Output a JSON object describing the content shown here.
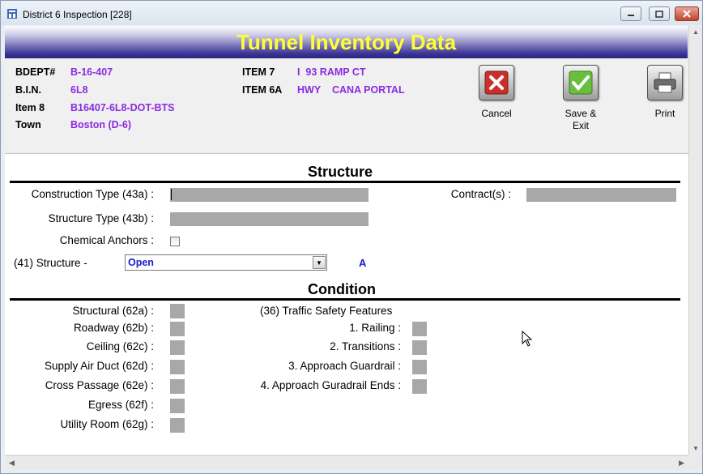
{
  "window": {
    "title": "District 6 Inspection [228]"
  },
  "banner": {
    "title": "Tunnel Inventory Data"
  },
  "header": {
    "bdept_label": "BDEPT#",
    "bdept_value": "B-16-407",
    "bin_label": "B.I.N.",
    "bin_value": "6L8",
    "item8_label": "Item 8",
    "item8_value": "B16407-6L8-DOT-BTS",
    "town_label": "Town",
    "town_value": "Boston (D-6)",
    "item7_label": "ITEM 7",
    "item7_value": "I  93 RAMP CT",
    "item6a_label": "ITEM 6A",
    "item6a_value1": "HWY",
    "item6a_value2": "CANA PORTAL"
  },
  "actions": {
    "cancel_label": "Cancel",
    "save_label_1": "Save &",
    "save_label_2": "Exit",
    "print_label": "Print"
  },
  "structure": {
    "title": "Structure",
    "construction_type_label": "Construction Type (43a) :",
    "structure_type_label": "Structure Type (43b) :",
    "contracts_label": "Contract(s) :",
    "chemical_anchors_label": "Chemical Anchors :",
    "structure_41_label": "(41) Structure -",
    "structure_41_value": "Open",
    "structure_41_code": "A"
  },
  "condition": {
    "title": "Condition",
    "items": [
      {
        "label": "Structural (62a) :"
      },
      {
        "label": "Roadway (62b) :"
      },
      {
        "label": "Ceiling (62c) :"
      },
      {
        "label": "Supply Air Duct (62d) :"
      },
      {
        "label": "Cross Passage (62e) :"
      },
      {
        "label": "Egress (62f) :"
      },
      {
        "label": "Utility Room (62g) :"
      }
    ],
    "traffic_title": "(36) Traffic Safety Features",
    "traffic_items": [
      {
        "label": "1. Railing :"
      },
      {
        "label": "2. Transitions :"
      },
      {
        "label": "3. Approach Guardrail :"
      },
      {
        "label": "4. Approach Guradrail Ends :"
      }
    ]
  },
  "colors": {
    "banner_text": "#ffff33",
    "header_values": "#8a2be2",
    "select_value": "#1a1acd",
    "field_gray": "#a8a8a8"
  }
}
